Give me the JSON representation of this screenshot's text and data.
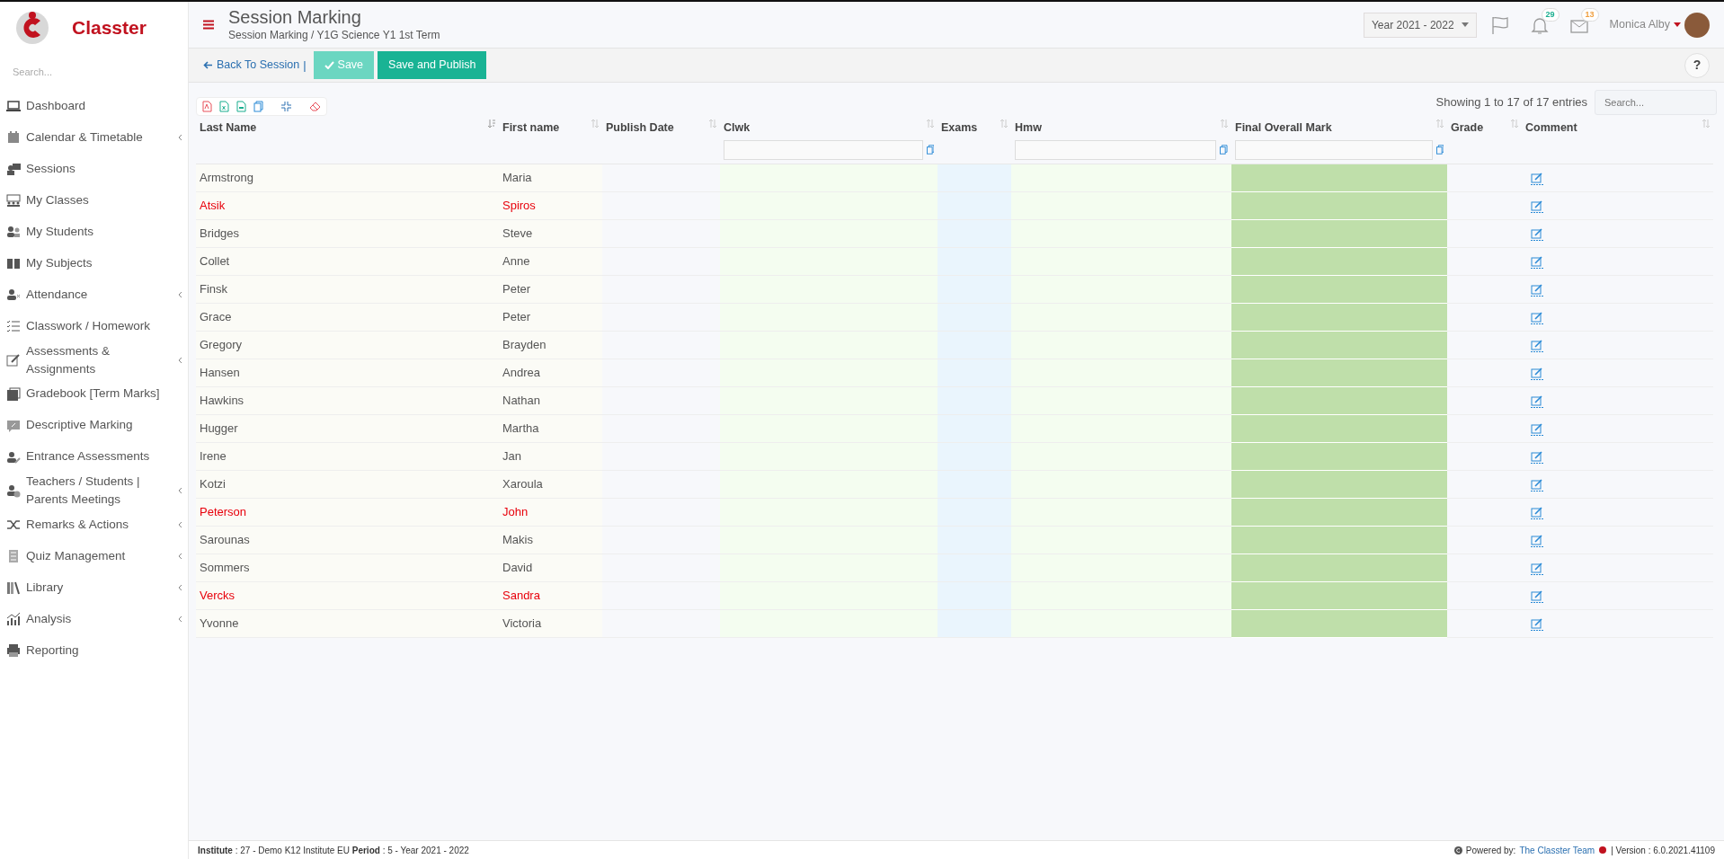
{
  "brand": {
    "name": "Classter"
  },
  "sidebar": {
    "search": {
      "placeholder": "Search..."
    },
    "items": [
      {
        "label": "Dashboard",
        "has_submenu": false
      },
      {
        "label": "Calendar & Timetable",
        "has_submenu": true
      },
      {
        "label": "Sessions",
        "has_submenu": false
      },
      {
        "label": "My Classes",
        "has_submenu": false
      },
      {
        "label": "My Students",
        "has_submenu": false
      },
      {
        "label": "My Subjects",
        "has_submenu": false
      },
      {
        "label": "Attendance",
        "has_submenu": true
      },
      {
        "label": "Classwork / Homework",
        "has_submenu": false
      },
      {
        "label": "Assessments & Assignments",
        "has_submenu": true
      },
      {
        "label": "Gradebook [Term Marks]",
        "has_submenu": false
      },
      {
        "label": "Descriptive Marking",
        "has_submenu": false
      },
      {
        "label": "Entrance Assessments",
        "has_submenu": false
      },
      {
        "label": "Teachers / Students | Parents Meetings",
        "has_submenu": true
      },
      {
        "label": "Remarks & Actions",
        "has_submenu": true
      },
      {
        "label": "Quiz Management",
        "has_submenu": true
      },
      {
        "label": "Library",
        "has_submenu": true
      },
      {
        "label": "Analysis",
        "has_submenu": true
      },
      {
        "label": "Reporting",
        "has_submenu": false
      }
    ]
  },
  "header": {
    "title": "Session Marking",
    "breadcrumb": "Session Marking / Y1G Science Y1 1st Term",
    "year": "Year 2021 - 2022",
    "notifications": [
      {
        "count": "29",
        "color": "#1aae8f"
      },
      {
        "count": "13",
        "color": "#f0a040"
      }
    ],
    "user": "Monica Alby"
  },
  "toolbar": {
    "back": "Back To Session",
    "separator": "|",
    "buttons": [
      {
        "label": "Save",
        "disabled": true
      },
      {
        "label": "Save and Publish",
        "disabled": false
      }
    ],
    "help": "?"
  },
  "table": {
    "info": "Showing 1 to 17 of 17 entries",
    "search": {
      "placeholder": "Search..."
    },
    "columns": [
      {
        "label": "Last Name",
        "sorted": true,
        "has_filter": false
      },
      {
        "label": "First name",
        "sorted": false,
        "has_filter": false
      },
      {
        "label": "Publish Date",
        "sorted": false,
        "has_filter": false
      },
      {
        "label": "Clwk",
        "sorted": false,
        "has_filter": true
      },
      {
        "label": "Exams",
        "sorted": false,
        "has_filter": false
      },
      {
        "label": "Hmw",
        "sorted": false,
        "has_filter": true
      },
      {
        "label": "Final Overall Mark",
        "sorted": false,
        "has_filter": true
      },
      {
        "label": "Grade",
        "sorted": false,
        "has_filter": false
      },
      {
        "label": "Comment",
        "sorted": false,
        "has_filter": false
      }
    ],
    "rows": [
      {
        "last_name": "Armstrong",
        "first_name": "Maria",
        "flagged": false
      },
      {
        "last_name": "Atsik",
        "first_name": "Spiros",
        "flagged": true
      },
      {
        "last_name": "Bridges",
        "first_name": "Steve",
        "flagged": false
      },
      {
        "last_name": "Collet",
        "first_name": "Anne",
        "flagged": false
      },
      {
        "last_name": "Finsk",
        "first_name": "Peter",
        "flagged": false
      },
      {
        "last_name": "Grace",
        "first_name": "Peter",
        "flagged": false
      },
      {
        "last_name": "Gregory",
        "first_name": "Brayden",
        "flagged": false
      },
      {
        "last_name": "Hansen",
        "first_name": "Andrea",
        "flagged": false
      },
      {
        "last_name": "Hawkins",
        "first_name": "Nathan",
        "flagged": false
      },
      {
        "last_name": "Hugger",
        "first_name": "Martha",
        "flagged": false
      },
      {
        "last_name": "Irene",
        "first_name": "Jan",
        "flagged": false
      },
      {
        "last_name": "Kotzi",
        "first_name": "Xaroula",
        "flagged": false
      },
      {
        "last_name": "Peterson",
        "first_name": "John",
        "flagged": true
      },
      {
        "last_name": "Sarounas",
        "first_name": "Makis",
        "flagged": false
      },
      {
        "last_name": "Sommers",
        "first_name": "David",
        "flagged": false
      },
      {
        "last_name": "Vercks",
        "first_name": "Sandra",
        "flagged": true
      },
      {
        "last_name": "Yvonne",
        "first_name": "Victoria",
        "flagged": false
      }
    ]
  },
  "footer": {
    "institute": "**Institute** : 27 - Demo K12 Institute EU **Period** : 5 - Year 2021 - 2022",
    "powered_by": "Powered by:",
    "team": "The Classter Team",
    "version": "| Version : 6.0.2021.41109"
  }
}
